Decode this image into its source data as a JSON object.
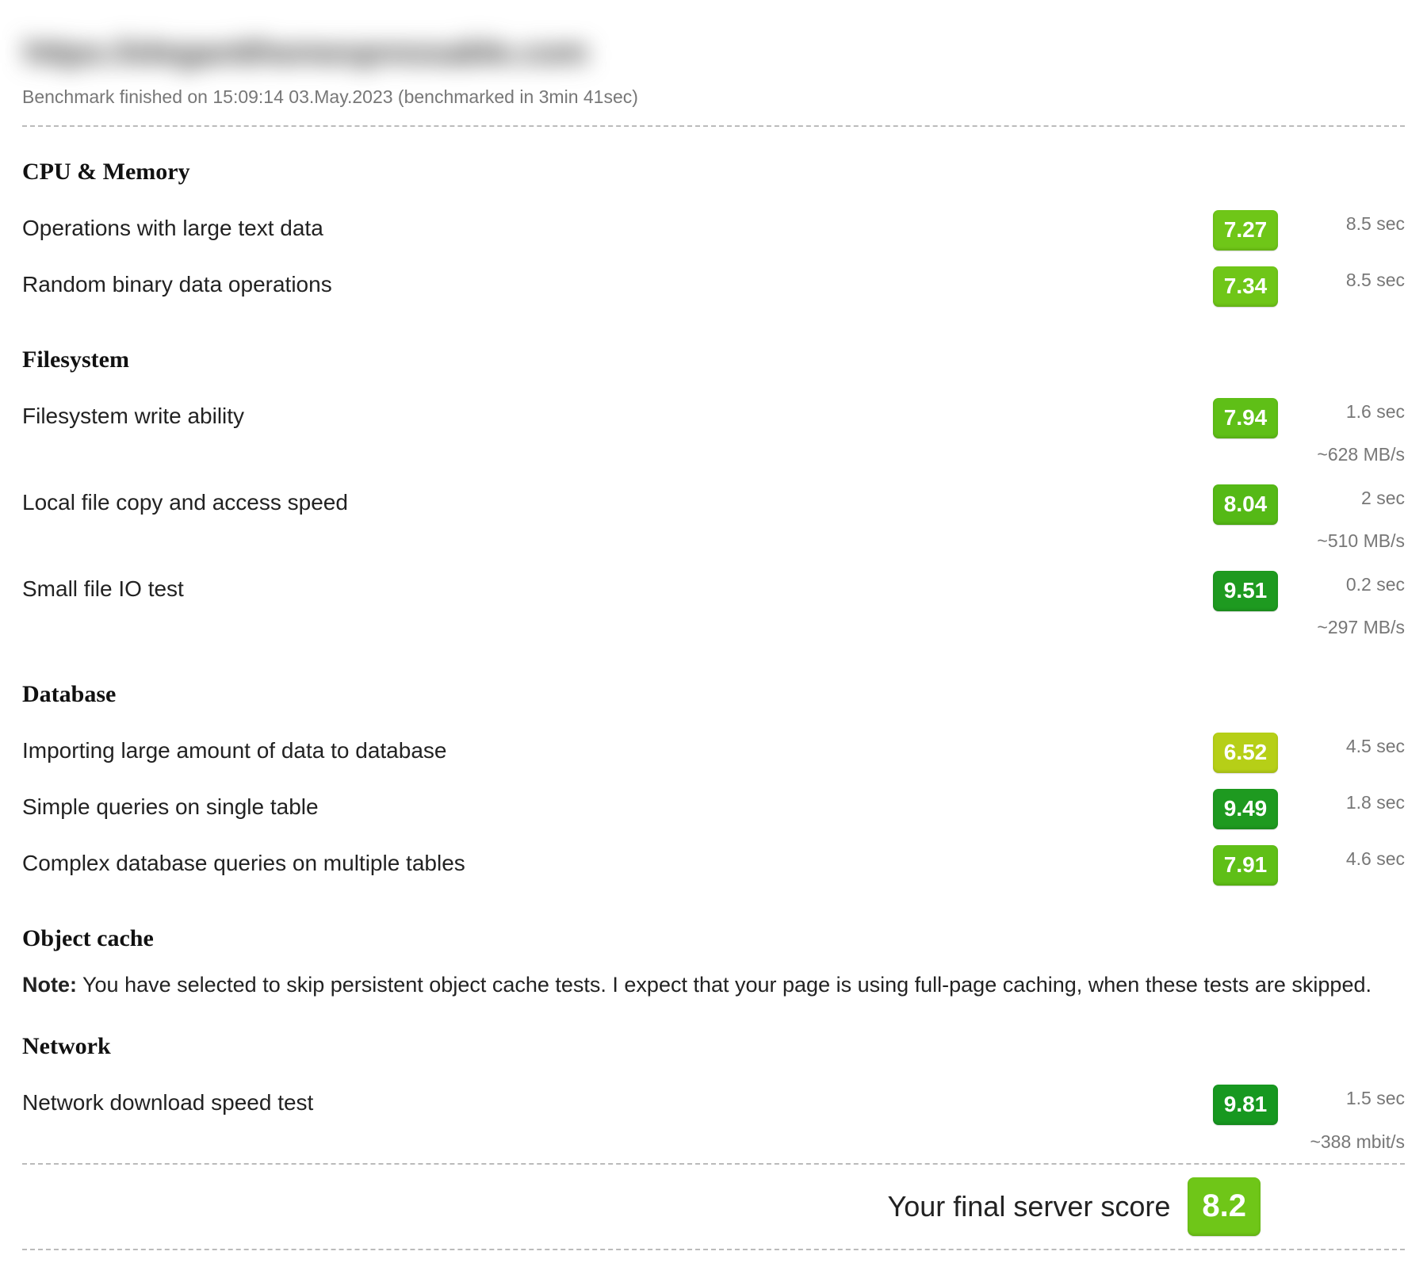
{
  "header": {
    "title_blurred": "https://elegantthemespressable.com",
    "benchmark_line": "Benchmark finished on 15:09:14 03.May.2023 (benchmarked in 3min 41sec)"
  },
  "sections": [
    {
      "title": "CPU & Memory",
      "rows": [
        {
          "label": "Operations with large text data",
          "score": "7.27",
          "score_color": "#6fc618",
          "time": "8.5 sec",
          "extra": ""
        },
        {
          "label": "Random binary data operations",
          "score": "7.34",
          "score_color": "#6fc618",
          "time": "8.5 sec",
          "extra": ""
        }
      ]
    },
    {
      "title": "Filesystem",
      "rows": [
        {
          "label": "Filesystem write ability",
          "score": "7.94",
          "score_color": "#5fbf17",
          "time": "1.6 sec",
          "extra": "~628 MB/s"
        },
        {
          "label": "Local file copy and access speed",
          "score": "8.04",
          "score_color": "#55b916",
          "time": "2 sec",
          "extra": "~510 MB/s"
        },
        {
          "label": "Small file IO test",
          "score": "9.51",
          "score_color": "#1e9a20",
          "time": "0.2 sec",
          "extra": "~297 MB/s"
        }
      ]
    },
    {
      "title": "Database",
      "rows": [
        {
          "label": "Importing large amount of data to database",
          "score": "6.52",
          "score_color": "#b6cf17",
          "time": "4.5 sec",
          "extra": ""
        },
        {
          "label": "Simple queries on single table",
          "score": "9.49",
          "score_color": "#1e9a20",
          "time": "1.8 sec",
          "extra": ""
        },
        {
          "label": "Complex database queries on multiple tables",
          "score": "7.91",
          "score_color": "#5fbf17",
          "time": "4.6 sec",
          "extra": ""
        }
      ]
    },
    {
      "title": "Object cache",
      "note_prefix": "Note:",
      "note": " You have selected to skip persistent object cache tests. I expect that your page is using full-page caching, when these tests are skipped.",
      "rows": []
    },
    {
      "title": "Network",
      "rows": [
        {
          "label": "Network download speed test",
          "score": "9.81",
          "score_color": "#179820",
          "time": "1.5 sec",
          "extra": "~388 mbit/s"
        }
      ]
    }
  ],
  "final": {
    "label": "Your final server score",
    "score": "8.2",
    "score_color": "#6fc618"
  }
}
